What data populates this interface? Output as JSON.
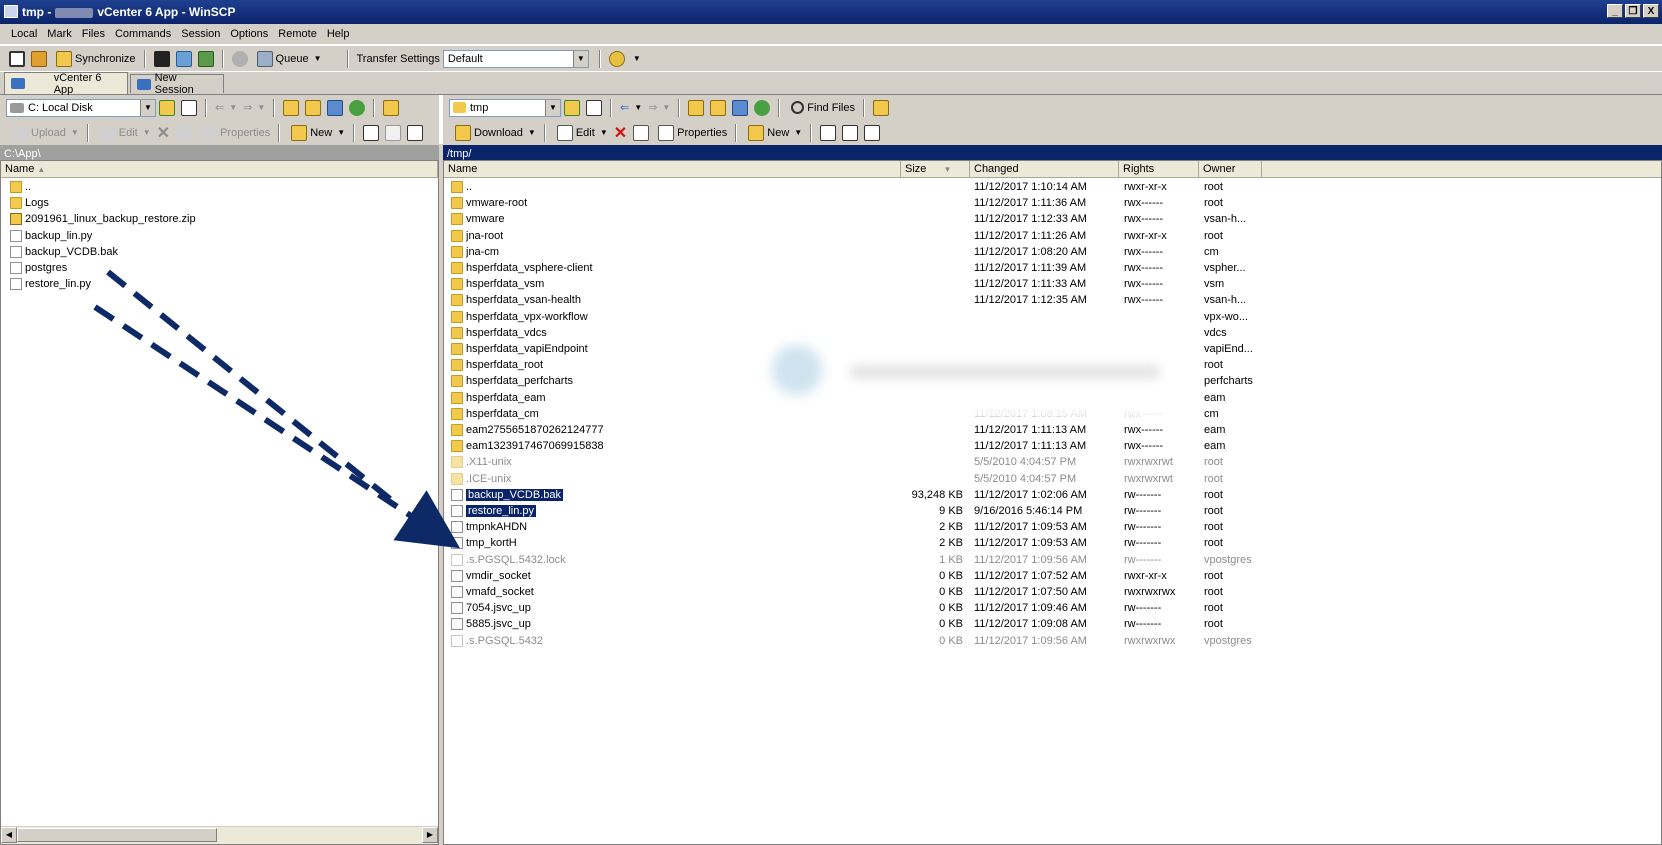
{
  "window": {
    "title_prefix": "tmp -",
    "title_suffix": "vCenter 6 App - WinSCP",
    "controls": [
      "_",
      "❐",
      "X"
    ]
  },
  "menu": [
    "Local",
    "Mark",
    "Files",
    "Commands",
    "Session",
    "Options",
    "Remote",
    "Help"
  ],
  "toolbar": {
    "synchronize": "Synchronize",
    "queue": "Queue",
    "transfer_settings_label": "Transfer Settings",
    "transfer_settings_value": "Default"
  },
  "tabs": {
    "session": "vCenter 6 App",
    "new_session": "New Session"
  },
  "local": {
    "drive": "C: Local Disk",
    "upload": "Upload",
    "edit": "Edit",
    "properties": "Properties",
    "new": "New",
    "path": "C:\\App\\",
    "col_name": "Name",
    "files": [
      {
        "name": "..",
        "type": "updir"
      },
      {
        "name": "Logs",
        "type": "folder"
      },
      {
        "name": "2091961_linux_backup_restore.zip",
        "type": "zip"
      },
      {
        "name": "backup_lin.py",
        "type": "file"
      },
      {
        "name": "backup_VCDB.bak",
        "type": "file"
      },
      {
        "name": "postgres",
        "type": "file"
      },
      {
        "name": "restore_lin.py",
        "type": "file"
      }
    ]
  },
  "remote": {
    "dir": "tmp",
    "find_files": "Find Files",
    "download": "Download",
    "edit": "Edit",
    "properties": "Properties",
    "new": "New",
    "path": "/tmp/",
    "columns": {
      "name": "Name",
      "size": "Size",
      "changed": "Changed",
      "rights": "Rights",
      "owner": "Owner"
    },
    "files": [
      {
        "name": "..",
        "type": "updir",
        "size": "",
        "changed": "11/12/2017 1:10:14 AM",
        "rights": "rwxr-xr-x",
        "owner": "root"
      },
      {
        "name": "vmware-root",
        "type": "folder",
        "size": "",
        "changed": "11/12/2017 1:11:36 AM",
        "rights": "rwx------",
        "owner": "root"
      },
      {
        "name": "vmware",
        "type": "folder",
        "size": "",
        "changed": "11/12/2017 1:12:33 AM",
        "rights": "rwx------",
        "owner": "vsan-h..."
      },
      {
        "name": "jna-root",
        "type": "folder",
        "size": "",
        "changed": "11/12/2017 1:11:26 AM",
        "rights": "rwxr-xr-x",
        "owner": "root"
      },
      {
        "name": "jna-cm",
        "type": "folder",
        "size": "",
        "changed": "11/12/2017 1:08:20 AM",
        "rights": "rwx------",
        "owner": "cm"
      },
      {
        "name": "hsperfdata_vsphere-client",
        "type": "folder",
        "size": "",
        "changed": "11/12/2017 1:11:39 AM",
        "rights": "rwx------",
        "owner": "vspher..."
      },
      {
        "name": "hsperfdata_vsm",
        "type": "folder",
        "size": "",
        "changed": "11/12/2017 1:11:33 AM",
        "rights": "rwx------",
        "owner": "vsm"
      },
      {
        "name": "hsperfdata_vsan-health",
        "type": "folder",
        "size": "",
        "changed": "11/12/2017 1:12:35 AM",
        "rights": "rwx------",
        "owner": "vsan-h..."
      },
      {
        "name": "hsperfdata_vpx-workflow",
        "type": "folder",
        "size": "",
        "changed": "",
        "rights": "",
        "owner": "vpx-wo..."
      },
      {
        "name": "hsperfdata_vdcs",
        "type": "folder",
        "size": "",
        "changed": "",
        "rights": "",
        "owner": "vdcs"
      },
      {
        "name": "hsperfdata_vapiEndpoint",
        "type": "folder",
        "size": "",
        "changed": "",
        "rights": "",
        "owner": "vapiEnd..."
      },
      {
        "name": "hsperfdata_root",
        "type": "folder",
        "size": "",
        "changed": "",
        "rights": "",
        "owner": "root"
      },
      {
        "name": "hsperfdata_perfcharts",
        "type": "folder",
        "size": "",
        "changed": "",
        "rights": "",
        "owner": "perfcharts"
      },
      {
        "name": "hsperfdata_eam",
        "type": "folder",
        "size": "",
        "changed": "",
        "rights": "",
        "owner": "eam"
      },
      {
        "name": "hsperfdata_cm",
        "type": "folder",
        "size": "",
        "changed": "11/12/2017 1:08:15 AM",
        "rights": "rwx------",
        "owner": "cm"
      },
      {
        "name": "eam2755651870262124777",
        "type": "folder",
        "size": "",
        "changed": "11/12/2017 1:11:13 AM",
        "rights": "rwx------",
        "owner": "eam"
      },
      {
        "name": "eam1323917467069915838",
        "type": "folder",
        "size": "",
        "changed": "11/12/2017 1:11:13 AM",
        "rights": "rwx------",
        "owner": "eam"
      },
      {
        "name": ".X11-unix",
        "type": "folder",
        "dim": true,
        "size": "",
        "changed": "5/5/2010 4:04:57 PM",
        "rights": "rwxrwxrwt",
        "owner": "root"
      },
      {
        "name": ".ICE-unix",
        "type": "folder",
        "dim": true,
        "size": "",
        "changed": "5/5/2010 4:04:57 PM",
        "rights": "rwxrwxrwt",
        "owner": "root"
      },
      {
        "name": "backup_VCDB.bak",
        "type": "file",
        "selected": true,
        "size": "93,248 KB",
        "changed": "11/12/2017 1:02:06 AM",
        "rights": "rw-------",
        "owner": "root"
      },
      {
        "name": "restore_lin.py",
        "type": "file",
        "selected": true,
        "size": "9 KB",
        "changed": "9/16/2016 5:46:14 PM",
        "rights": "rw-------",
        "owner": "root"
      },
      {
        "name": "tmpnkAHDN",
        "type": "file",
        "size": "2 KB",
        "changed": "11/12/2017 1:09:53 AM",
        "rights": "rw-------",
        "owner": "root"
      },
      {
        "name": "tmp_kortH",
        "type": "file",
        "size": "2 KB",
        "changed": "11/12/2017 1:09:53 AM",
        "rights": "rw-------",
        "owner": "root"
      },
      {
        "name": ".s.PGSQL.5432.lock",
        "type": "file",
        "dim": true,
        "size": "1 KB",
        "changed": "11/12/2017 1:09:56 AM",
        "rights": "rw-------",
        "owner": "vpostgres"
      },
      {
        "name": "vmdir_socket",
        "type": "file",
        "size": "0 KB",
        "changed": "11/12/2017 1:07:52 AM",
        "rights": "rwxr-xr-x",
        "owner": "root"
      },
      {
        "name": "vmafd_socket",
        "type": "file",
        "size": "0 KB",
        "changed": "11/12/2017 1:07:50 AM",
        "rights": "rwxrwxrwx",
        "owner": "root"
      },
      {
        "name": "7054.jsvc_up",
        "type": "file",
        "size": "0 KB",
        "changed": "11/12/2017 1:09:46 AM",
        "rights": "rw-------",
        "owner": "root"
      },
      {
        "name": "5885.jsvc_up",
        "type": "file",
        "size": "0 KB",
        "changed": "11/12/2017 1:09:08 AM",
        "rights": "rw-------",
        "owner": "root"
      },
      {
        "name": ".s.PGSQL.5432",
        "type": "file",
        "dim": true,
        "size": "0 KB",
        "changed": "11/12/2017 1:09:56 AM",
        "rights": "rwxrwxrwx",
        "owner": "vpostgres"
      }
    ]
  },
  "colors": {
    "title_bar": "#0a246a",
    "remote_path_bar": "#0a246a",
    "local_path_bar": "#a0a0a0",
    "selection": "#0a246a",
    "annotation_arrow": "#0e2a66"
  }
}
